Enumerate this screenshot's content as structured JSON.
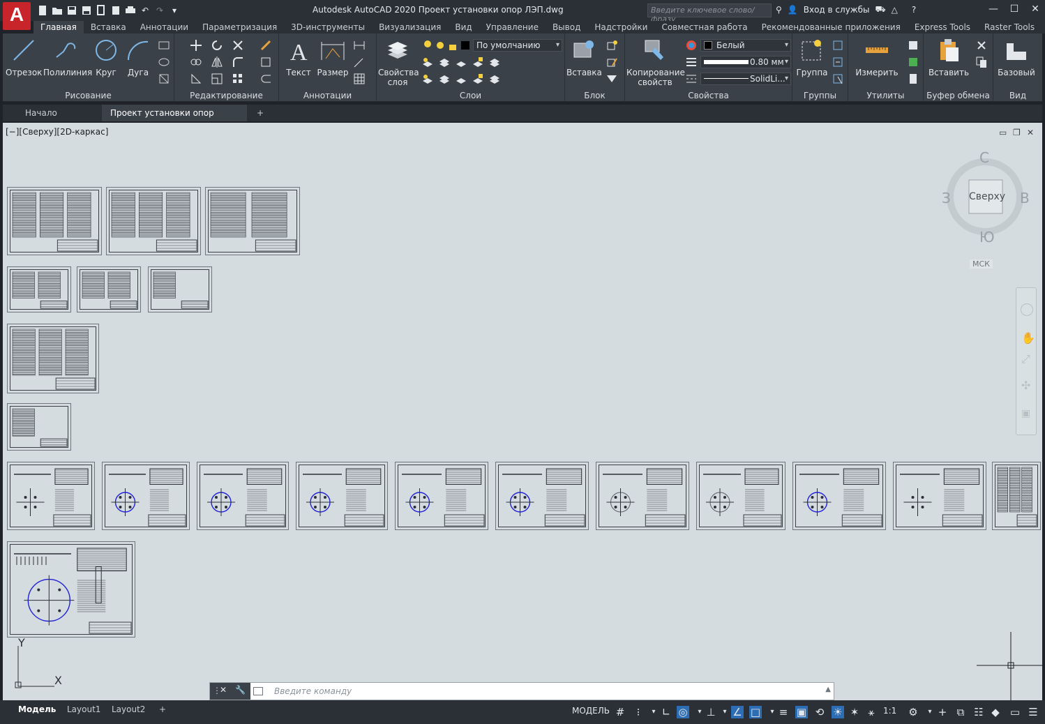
{
  "app": {
    "logo_letter": "A",
    "title": "Autodesk AutoCAD 2020   Проект установки опор ЛЭП.dwg",
    "search_placeholder": "Введите ключевое слово/фразу",
    "signin": "Вход в службы",
    "window_controls": [
      "minimize-icon",
      "maximize-icon",
      "close-icon"
    ]
  },
  "ribbon_tabs": [
    "Главная",
    "Вставка",
    "Аннотации",
    "Параметризация",
    "3D-инструменты",
    "Визуализация",
    "Вид",
    "Управление",
    "Вывод",
    "Надстройки",
    "Совместная работа",
    "Рекомендованные приложения",
    "Express Tools",
    "Raster Tools"
  ],
  "ribbon": {
    "draw": {
      "title": "Рисование",
      "buttons": [
        "Отрезок",
        "Полилиния",
        "Круг",
        "Дуга"
      ]
    },
    "modify": {
      "title": "Редактирование"
    },
    "annotation": {
      "title": "Аннотации",
      "buttons": [
        "Текст",
        "Размер"
      ]
    },
    "layers": {
      "title": "Слои",
      "button_line1": "Свойства",
      "button_line2": "слоя",
      "current_layer": "По умолчанию"
    },
    "block": {
      "title": "Блок",
      "button": "Вставка"
    },
    "properties": {
      "title": "Свойства",
      "copy_line1": "Копирование",
      "copy_line2": "свойств",
      "color": "Белый",
      "lineweight": "0.80 мм",
      "linetype": "SolidLi..."
    },
    "groups": {
      "title": "Группы",
      "button": "Группа"
    },
    "utilities": {
      "title": "Утилиты",
      "button": "Измерить"
    },
    "clipboard": {
      "title": "Буфер обмена",
      "button": "Вставить"
    },
    "view": {
      "title": "Вид",
      "button": "Базовый"
    }
  },
  "doc_tabs": {
    "start": "Начало",
    "current": "Проект установки опор ЛЭП*",
    "new": "+"
  },
  "viewport": {
    "label": "[−][Сверху][2D-каркас]",
    "viewcube": {
      "n": "С",
      "s": "Ю",
      "w": "З",
      "e": "В",
      "face": "Сверху",
      "ucs": "МСК"
    },
    "ucs_axes": {
      "x": "X",
      "y": "Y"
    }
  },
  "command": {
    "placeholder": "Введите команду"
  },
  "status": {
    "layouts": [
      "Модель",
      "Layout1",
      "Layout2",
      "+"
    ],
    "model": "МОДЕЛЬ",
    "scale": "1:1"
  }
}
